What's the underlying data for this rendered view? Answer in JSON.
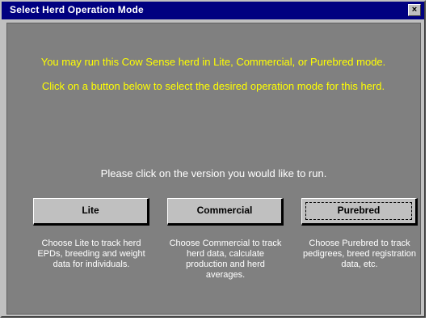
{
  "window": {
    "title": "Select Herd Operation Mode",
    "close_glyph": "×"
  },
  "intro": {
    "line1": "You may run this Cow Sense herd in Lite, Commercial, or Purebred mode.",
    "line2": "Click on a button below to select the desired operation mode for this herd."
  },
  "prompt": "Please click on the version you would like to run.",
  "modes": [
    {
      "label": "Lite",
      "description": "Choose Lite to track herd EPDs, breeding and weight data for individuals."
    },
    {
      "label": "Commercial",
      "description": "Choose Commercial to track herd data, calculate production and herd averages."
    },
    {
      "label": "Purebred",
      "description": "Choose Purebred to track pedigrees, breed registration data, etc."
    }
  ],
  "colors": {
    "titlebar": "#000080",
    "client_bg": "#808080",
    "intro_text": "#ffff00",
    "body_text": "#ffffff",
    "button_face": "#c0c0c0"
  }
}
